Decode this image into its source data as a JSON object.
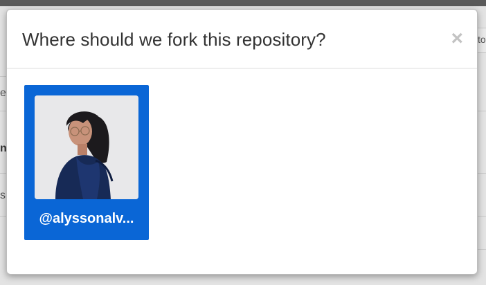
{
  "modal": {
    "title": "Where should we fork this repository?",
    "close_glyph": "×"
  },
  "owners": [
    {
      "handle": "@alyssonalv..."
    }
  ],
  "background": {
    "stub_right": "to",
    "stub_a": "ed",
    "stub_b": "n",
    "stub_c": "s"
  }
}
